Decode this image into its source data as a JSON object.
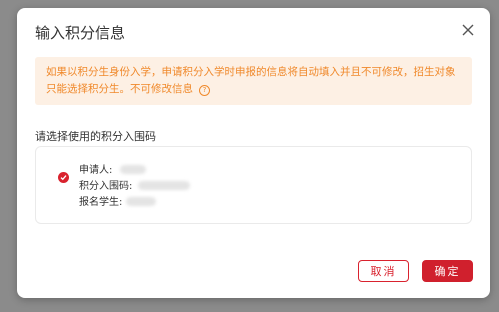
{
  "dialog": {
    "title": "输入积分信息",
    "close_icon": "close-icon",
    "notice": {
      "text": "如果以积分生身份入学，申请积分入学时申报的信息将自动填入并且不可修改，招生对象只能选择积分生。不可修改信息",
      "help_icon": "question-circle-icon"
    },
    "section_label": "请选择使用的积分入围码",
    "option": {
      "selected": true,
      "applicant_label": "申请人:",
      "code_label": "积分入围码:",
      "student_label": "报名学生:"
    },
    "buttons": {
      "cancel_label": "取消",
      "confirm_label": "确定"
    }
  },
  "colors": {
    "brand_red": "#d9222e",
    "notice_text": "#f0892b",
    "notice_bg": "#fdf0e4",
    "overlay": "#8b8b8b"
  }
}
